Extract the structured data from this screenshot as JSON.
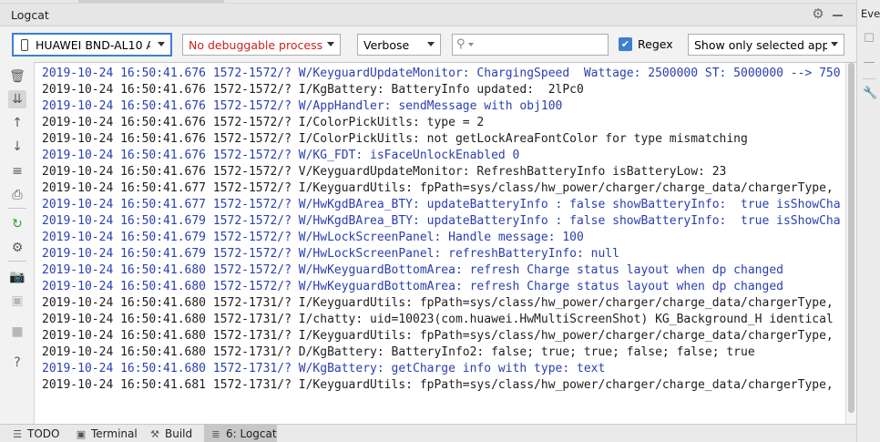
{
  "window": {
    "title": "Logcat",
    "right_panel_label": "Eve"
  },
  "toolbar": {
    "device": "HUAWEI BND-AL10 A",
    "process": "No debuggable process",
    "level": "Verbose",
    "search_placeholder": "",
    "regex_label": "Regex",
    "regex_checked": true,
    "filter": "Show only selected appl"
  },
  "log": {
    "lines": [
      {
        "level": "W",
        "text": "2019-10-24 16:50:41.676 1572-1572/? W/KeyguardUpdateMonitor: ChargingSpeed  Wattage: 2500000 ST: 5000000 --> 750"
      },
      {
        "level": "I",
        "text": "2019-10-24 16:50:41.676 1572-1572/? I/KgBattery: BatteryInfo updated:  2lPc0"
      },
      {
        "level": "W",
        "text": "2019-10-24 16:50:41.676 1572-1572/? W/AppHandler: sendMessage with obj100"
      },
      {
        "level": "I",
        "text": "2019-10-24 16:50:41.676 1572-1572/? I/ColorPickUitls: type = 2"
      },
      {
        "level": "I",
        "text": "2019-10-24 16:50:41.676 1572-1572/? I/ColorPickUitls: not getLockAreaFontColor for type mismatching"
      },
      {
        "level": "W",
        "text": "2019-10-24 16:50:41.676 1572-1572/? W/KG_FDT: isFaceUnlockEnabled 0"
      },
      {
        "level": "V",
        "text": "2019-10-24 16:50:41.676 1572-1572/? V/KeyguardUpdateMonitor: RefreshBatteryInfo isBatteryLow: 23"
      },
      {
        "level": "I",
        "text": "2019-10-24 16:50:41.677 1572-1572/? I/KeyguardUtils: fpPath=sys/class/hw_power/charger/charge_data/chargerType,"
      },
      {
        "level": "W",
        "text": "2019-10-24 16:50:41.677 1572-1572/? W/HwKgdBArea_BTY: updateBatteryInfo : false showBatteryInfo:  true isShowCha"
      },
      {
        "level": "W",
        "text": "2019-10-24 16:50:41.679 1572-1572/? W/HwKgdBArea_BTY: updateBatteryInfo : false showBatteryInfo:  true isShowCha"
      },
      {
        "level": "W",
        "text": "2019-10-24 16:50:41.679 1572-1572/? W/HwLockScreenPanel: Handle message: 100"
      },
      {
        "level": "W",
        "text": "2019-10-24 16:50:41.679 1572-1572/? W/HwLockScreenPanel: refreshBatteryInfo: null"
      },
      {
        "level": "W",
        "text": "2019-10-24 16:50:41.680 1572-1572/? W/HwKeyguardBottomArea: refresh Charge status layout when dp changed"
      },
      {
        "level": "W",
        "text": "2019-10-24 16:50:41.680 1572-1572/? W/HwKeyguardBottomArea: refresh Charge status layout when dp changed"
      },
      {
        "level": "I",
        "text": "2019-10-24 16:50:41.680 1572-1731/? I/KeyguardUtils: fpPath=sys/class/hw_power/charger/charge_data/chargerType,"
      },
      {
        "level": "I",
        "text": "2019-10-24 16:50:41.680 1572-1731/? I/chatty: uid=10023(com.huawei.HwMultiScreenShot) KG_Background_H identical"
      },
      {
        "level": "I",
        "text": "2019-10-24 16:50:41.680 1572-1731/? I/KeyguardUtils: fpPath=sys/class/hw_power/charger/charge_data/chargerType,"
      },
      {
        "level": "D",
        "text": "2019-10-24 16:50:41.680 1572-1731/? D/KgBattery: BatteryInfo2: false; true; true; false; false; true"
      },
      {
        "level": "W",
        "text": "2019-10-24 16:50:41.680 1572-1731/? W/KgBattery: getCharge info with type: text"
      },
      {
        "level": "I",
        "text": "2019-10-24 16:50:41.681 1572-1731/? I/KeyguardUtils: fpPath=sys/class/hw_power/charger/charge_data/chargerType,"
      }
    ]
  },
  "bottom_tabs": [
    {
      "label": "TODO",
      "icon": "list-icon",
      "active": false
    },
    {
      "label": "Terminal",
      "icon": "terminal-icon",
      "active": false
    },
    {
      "label": "Build",
      "icon": "hammer-icon",
      "active": false
    },
    {
      "label": "6: Logcat",
      "icon": "logcat-icon",
      "active": true
    }
  ]
}
